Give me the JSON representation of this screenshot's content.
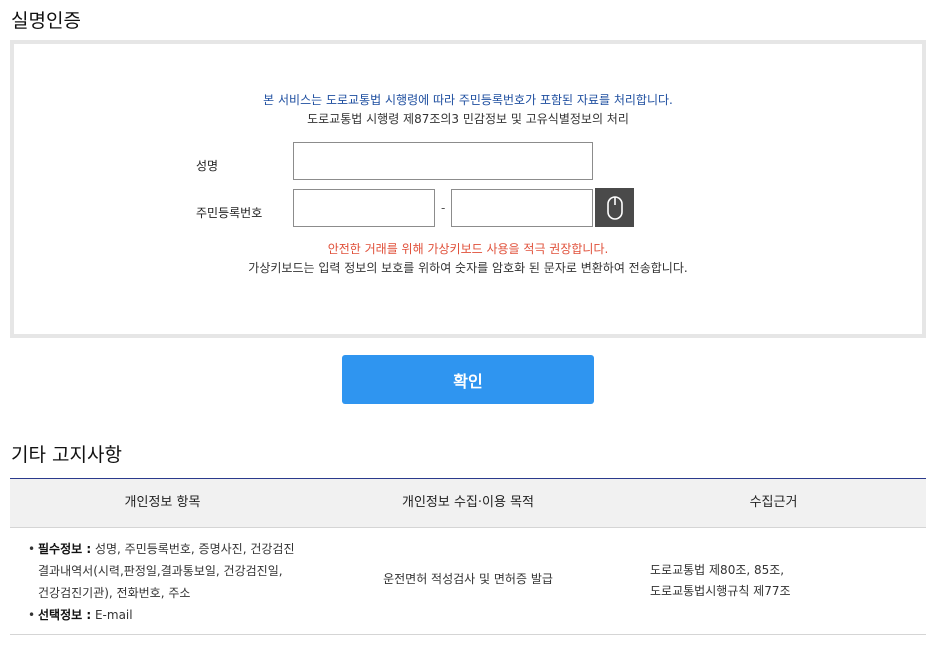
{
  "auth": {
    "title": "실명인증",
    "notice_line1": "본 서비스는 도로교통법 시행령에 따라 주민등록번호가 포함된 자료를 처리합니다.",
    "notice_line2": "도로교통법 시행령 제87조의3 민감정보 및 고유식별정보의 처리",
    "name_label": "성명",
    "name_value": "",
    "rrn_label": "주민등록번호",
    "rrn_front_value": "",
    "rrn_back_value": "",
    "rrn_separator": "-",
    "virtual_keyboard_icon": "mouse-icon",
    "warning_red": "안전한 거래를 위해 가상키보드 사용을 적극 권장합니다.",
    "warning_black": "가상키보드는 입력 정보의 보호를 위하여 숫자를 암호화 된 문자로 변환하여 전송합니다.",
    "confirm_label": "확인"
  },
  "notice": {
    "title": "기타 고지사항",
    "headers": [
      "개인정보 항목",
      "개인정보 수집·이용 목적",
      "수집근거"
    ],
    "required_label": "필수정보 :",
    "required_text": "성명, 주민등록번호, 증명사진, 건강검진",
    "required_text2": "결과내역서(시력,판정일,결과통보일, 건강검진일,",
    "required_text3": "건강검진기관), 전화번호, 주소",
    "optional_label": "선택정보 :",
    "optional_text": "E-mail",
    "purpose": "운전면허 적성검사 및 면허증 발급",
    "basis_line1": "도로교통법 제80조, 85조,",
    "basis_line2": "도로교통법시행규칙 제77조"
  },
  "colors": {
    "primary_button": "#2f95f0",
    "notice_blue": "#1f4fa0",
    "warning_red": "#e0503a",
    "table_top_border": "#2b3a8c"
  }
}
